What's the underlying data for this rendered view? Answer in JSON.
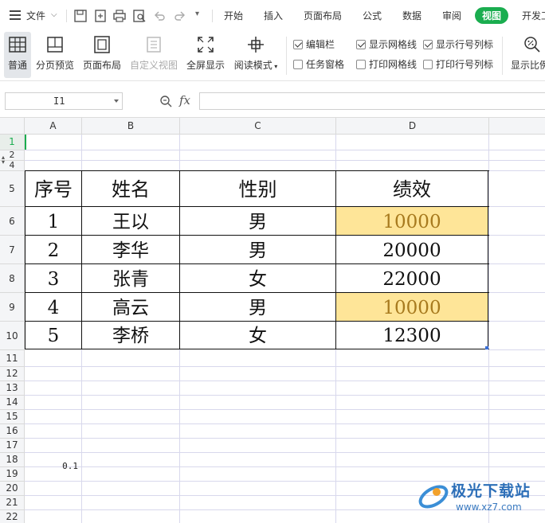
{
  "menu": {
    "file_label": "文件",
    "tabs": [
      "开始",
      "插入",
      "页面布局",
      "公式",
      "数据",
      "审阅",
      "视图",
      "开发工"
    ],
    "active_tab": "视图",
    "active_color": "#1aad4f"
  },
  "toolbar": {
    "normal": "普通",
    "page_break_preview": "分页预览",
    "page_layout": "页面布局",
    "custom_view": "自定义视图",
    "fullscreen": "全屏显示",
    "reading_mode": "阅读模式",
    "zoom": "显示比例",
    "checkboxes": {
      "formula_bar": {
        "label": "编辑栏",
        "checked": true
      },
      "task_pane": {
        "label": "任务窗格",
        "checked": false
      },
      "show_gridlines": {
        "label": "显示网格线",
        "checked": true
      },
      "print_gridlines": {
        "label": "打印网格线",
        "checked": false
      },
      "show_headings": {
        "label": "显示行号列标",
        "checked": true
      },
      "print_headings": {
        "label": "打印行号列标",
        "checked": false
      }
    }
  },
  "formula_bar": {
    "cell_ref": "I1",
    "fx": "fx",
    "value": ""
  },
  "sheet": {
    "columns": [
      "A",
      "B",
      "C",
      "D"
    ],
    "rows": [
      "1",
      "2",
      "4",
      "5",
      "6",
      "7",
      "8",
      "9",
      "10",
      "11",
      "12",
      "13",
      "14",
      "15",
      "16",
      "17",
      "18",
      "19",
      "20",
      "21",
      "22"
    ],
    "header": [
      "序号",
      "姓名",
      "性别",
      "绩效"
    ],
    "data": [
      [
        "1",
        "王以",
        "男",
        "10000"
      ],
      [
        "2",
        "李华",
        "男",
        "20000"
      ],
      [
        "3",
        "张青",
        "女",
        "22000"
      ],
      [
        "4",
        "高云",
        "男",
        "10000"
      ],
      [
        "5",
        "李桥",
        "女",
        "12300"
      ]
    ],
    "highlight_color": "#fee598",
    "highlight_text_color": "#a77a1e",
    "a18_value": "0.1"
  },
  "watermark": {
    "title": "极光下载站",
    "url": "www.xz7.com"
  }
}
